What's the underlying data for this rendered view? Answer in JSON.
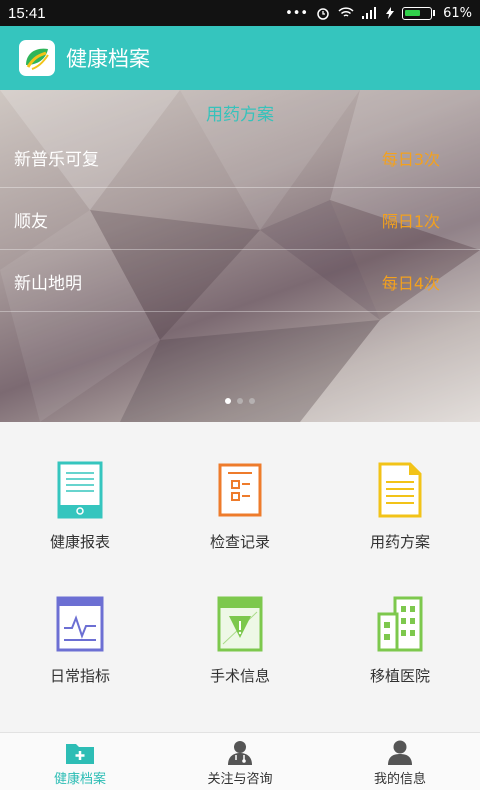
{
  "status": {
    "time": "15:41",
    "dots": "•••",
    "battery_pct": "61%"
  },
  "header": {
    "title": "健康档案"
  },
  "banner": {
    "title": "用药方案",
    "items": [
      {
        "name": "新普乐可复",
        "freq": "每日3次"
      },
      {
        "name": "顺友",
        "freq": "隔日1次"
      },
      {
        "name": "新山地明",
        "freq": "每日4次"
      }
    ],
    "page_indicator": {
      "count": 3,
      "active": 0
    }
  },
  "menu": [
    {
      "label": "健康报表",
      "icon": "report-icon"
    },
    {
      "label": "检查记录",
      "icon": "checklist-icon"
    },
    {
      "label": "用药方案",
      "icon": "document-icon"
    },
    {
      "label": "日常指标",
      "icon": "monitor-icon"
    },
    {
      "label": "手术信息",
      "icon": "surgery-icon"
    },
    {
      "label": "移植医院",
      "icon": "hospital-icon"
    }
  ],
  "tabs": [
    {
      "label": "健康档案",
      "active": true
    },
    {
      "label": "关注与咨询",
      "active": false
    },
    {
      "label": "我的信息",
      "active": false
    }
  ],
  "colors": {
    "accent": "#35c5be",
    "frequency": "#f3a11e",
    "active_tab": "#2dbdb5"
  }
}
